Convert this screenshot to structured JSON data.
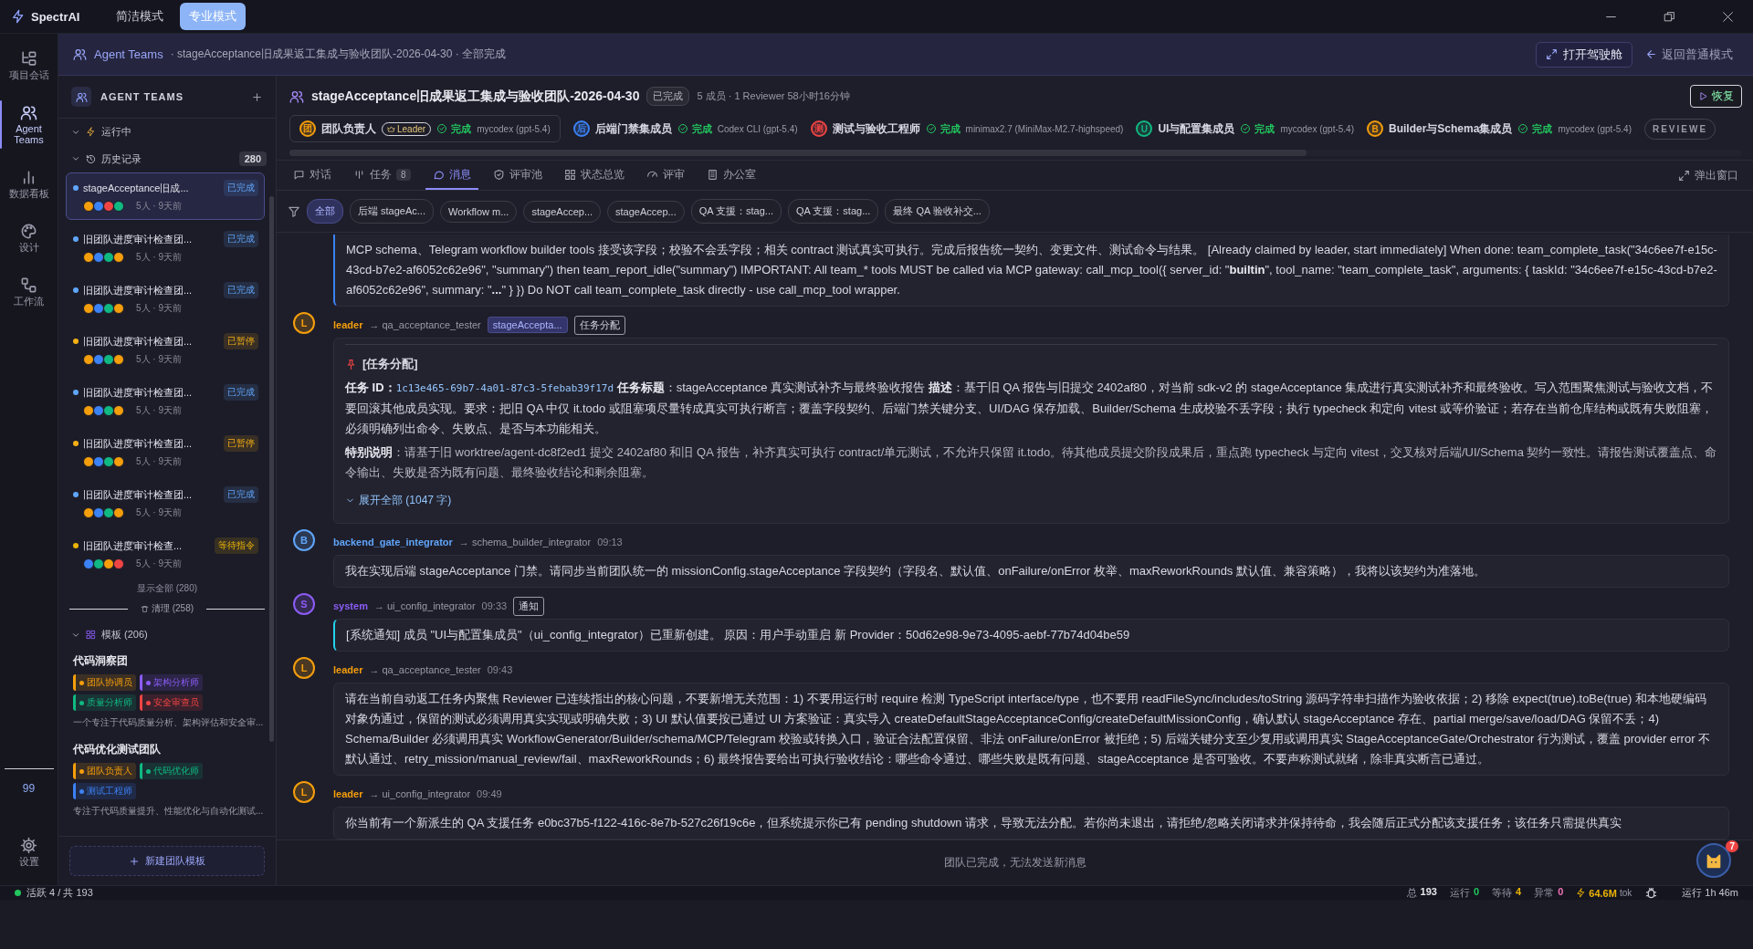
{
  "app": {
    "name": "SpectrAI",
    "modes": [
      {
        "label": "简洁模式",
        "selected": false
      },
      {
        "label": "专业模式",
        "selected": true
      }
    ]
  },
  "rail": {
    "items": [
      {
        "label": "项目会话",
        "selected": false
      },
      {
        "label": "Agent Teams",
        "selected": true
      },
      {
        "label": "数据看板",
        "selected": false
      },
      {
        "label": "设计",
        "selected": false
      },
      {
        "label": "工作流",
        "selected": false
      }
    ],
    "badge": "99",
    "settings": "设置"
  },
  "breadcrumb": {
    "section": "Agent Teams",
    "path": "· stageAcceptance旧成果返工集成与验收团队-2026-04-30 · 全部完成",
    "cockpit": "打开驾驶舱",
    "back": "返回普通模式"
  },
  "sidebar": {
    "title": "AGENT TEAMS",
    "running": "运行中",
    "history": "历史记录",
    "history_count": "280",
    "teams": [
      {
        "title": "stageAcceptance旧成...",
        "status": "已完成",
        "color": "#60a5fa",
        "meta": "5人 · 9天前",
        "selected": true,
        "avatars": [
          {
            "color": "#f59e0b"
          },
          {
            "color": "#3b82f6"
          },
          {
            "color": "#ef4444"
          },
          {
            "color": "#10b981"
          }
        ]
      },
      {
        "title": "旧团队进度审计检查团...",
        "status": "已完成",
        "color": "#60a5fa",
        "meta": "5人 · 9天前",
        "selected": false,
        "avatars": [
          {
            "color": "#f59e0b"
          },
          {
            "color": "#3b82f6"
          },
          {
            "color": "#10b981"
          },
          {
            "color": "#f59e0b"
          }
        ]
      },
      {
        "title": "旧团队进度审计检查团...",
        "status": "已完成",
        "color": "#60a5fa",
        "meta": "5人 · 9天前",
        "selected": false,
        "avatars": [
          {
            "color": "#f59e0b"
          },
          {
            "color": "#3b82f6"
          },
          {
            "color": "#10b981"
          },
          {
            "color": "#f59e0b"
          }
        ]
      },
      {
        "title": "旧团队进度审计检查团...",
        "status": "已暂停",
        "color": "#f5b014",
        "meta": "5人 · 9天前",
        "selected": false,
        "avatars": [
          {
            "color": "#f59e0b"
          },
          {
            "color": "#3b82f6"
          },
          {
            "color": "#10b981"
          },
          {
            "color": "#f59e0b"
          }
        ]
      },
      {
        "title": "旧团队进度审计检查团...",
        "status": "已完成",
        "color": "#60a5fa",
        "meta": "5人 · 9天前",
        "selected": false,
        "avatars": [
          {
            "color": "#f59e0b"
          },
          {
            "color": "#3b82f6"
          },
          {
            "color": "#10b981"
          },
          {
            "color": "#f59e0b"
          }
        ]
      },
      {
        "title": "旧团队进度审计检查团...",
        "status": "已暂停",
        "color": "#f5b014",
        "meta": "5人 · 9天前",
        "selected": false,
        "avatars": [
          {
            "color": "#f59e0b"
          },
          {
            "color": "#3b82f6"
          },
          {
            "color": "#10b981"
          },
          {
            "color": "#f59e0b"
          }
        ]
      },
      {
        "title": "旧团队进度审计检查团...",
        "status": "已完成",
        "color": "#60a5fa",
        "meta": "5人 · 9天前",
        "selected": false,
        "avatars": [
          {
            "color": "#f59e0b"
          },
          {
            "color": "#3b82f6"
          },
          {
            "color": "#10b981"
          },
          {
            "color": "#f59e0b"
          }
        ]
      },
      {
        "title": "旧团队进度审计检查...",
        "status": "等待指令",
        "color": "#eab308",
        "meta": "5人 · 9天前",
        "selected": false,
        "avatars": [
          {
            "color": "#3b82f6"
          },
          {
            "color": "#10b981"
          },
          {
            "color": "#f59e0b"
          },
          {
            "color": "#ef4444"
          }
        ]
      }
    ],
    "show_all": "显示全部 (280)",
    "cleanup": "清理 (258)",
    "templates_label": "模板 (206)",
    "templates": [
      {
        "name": "代码洞察团",
        "roles": [
          {
            "label": "团队协调员",
            "color": "#f59e0b"
          },
          {
            "label": "架构分析师",
            "color": "#8b5cf6"
          },
          {
            "label": "质量分析师",
            "color": "#10b981"
          },
          {
            "label": "安全审查员",
            "color": "#ef4444"
          }
        ],
        "description": "一个专注于代码质量分析、架构评估和安全审..."
      },
      {
        "name": "代码优化测试团队",
        "roles": [
          {
            "label": "团队负责人",
            "color": "#f59e0b"
          },
          {
            "label": "代码优化师",
            "color": "#10b981"
          },
          {
            "label": "测试工程师",
            "color": "#3b82f6"
          }
        ],
        "description": "专注于代码质量提升、性能优化与自动化测试..."
      }
    ],
    "new_template": "新建团队模板"
  },
  "team": {
    "title": "stageAcceptance旧成果返工集成与验收团队-2026-04-30",
    "status": "已完成",
    "meta": "5 成员 · 1 Reviewer 58小时16分钟",
    "resume": "恢复",
    "members": [
      {
        "avatar": "团",
        "color": "#f59e0b",
        "name": "团队负责人",
        "badge": "Leader",
        "status": "完成",
        "model": "mycodex (gpt-5.4)"
      },
      {
        "avatar": "后",
        "color": "#3b82f6",
        "name": "后端门禁集成员",
        "status": "完成",
        "model": "Codex CLI (gpt-5.4)"
      },
      {
        "avatar": "测",
        "color": "#ef4444",
        "name": "测试与验收工程师",
        "status": "完成",
        "model": "minimax2.7 (MiniMax-M2.7-highspeed)"
      },
      {
        "avatar": "U",
        "color": "#10b981",
        "name": "UI与配置集成员",
        "status": "完成",
        "model": "mycodex (gpt-5.4)"
      },
      {
        "avatar": "B",
        "color": "#f59e0b",
        "name": "Builder与Schema集成员",
        "status": "完成",
        "model": "mycodex (gpt-5.4)"
      }
    ],
    "reviewer": "REVIEWE"
  },
  "tabs": [
    {
      "label": "对话",
      "selected": false
    },
    {
      "label": "任务",
      "count": "8",
      "selected": false
    },
    {
      "label": "消息",
      "selected": true
    },
    {
      "label": "评审池",
      "selected": false
    },
    {
      "label": "状态总览",
      "selected": false
    },
    {
      "label": "评审",
      "selected": false
    },
    {
      "label": "办公室",
      "selected": false
    }
  ],
  "popout": "弹出窗口",
  "filters": [
    {
      "label": "全部",
      "selected": true
    },
    {
      "label": "后端 stageAc...",
      "selected": false
    },
    {
      "label": "Workflow m...",
      "selected": false
    },
    {
      "label": "stageAccep...",
      "selected": false
    },
    {
      "label": "stageAccep...",
      "selected": false
    },
    {
      "label": "QA 支援：stag...",
      "selected": false
    },
    {
      "label": "QA 支援：stag...",
      "selected": false
    },
    {
      "label": "最终 QA 验收补交...",
      "selected": false
    }
  ],
  "messages": [
    {
      "kind": "continuation",
      "text": "MCP schema、Telegram workflow builder tools 接受该字段；校验不会丢字段；相关 contract 测试真实可执行。完成后报告统一契约、变更文件、测试命令与结果。 [Already claimed by leader, start immediately] When done: team_complete_task(\"34c6ee7f-e15c-43cd-b7e2-af6052c62e96\", \"summary\") then team_report_idle(\"summary\") IMPORTANT: All team_* tools MUST be called via MCP gateway: call_mcp_tool({ server_id: \"**builtin**\", tool_name: \"team_complete_task\", arguments: { taskId: \"34c6ee7f-e15c-43cd-b7e2-af6052c62e96\", summary: \"**...**\" } }) Do NOT call team_complete_task directly - use call_mcp_tool wrapper."
    },
    {
      "kind": "task",
      "sender": "leader",
      "avatar": "L",
      "color": "#f59e0b",
      "to": "→ qa_acceptance_tester",
      "tags": [
        {
          "label": "stageAccepta...",
          "kind": "topic"
        },
        {
          "label": "任务分配",
          "kind": "type"
        }
      ],
      "heading": "[任务分配]",
      "id_label": "任务 ID：",
      "task_id": "1c13e465-69b7-4a01-87c3-5febab39f17d",
      "description": "**任务标题**：stageAcceptance 真实测试补齐与最终验收报告 **描述**：基于旧 QA 报告与旧提交 2402af80，对当前 sdk-v2 的 stageAcceptance 集成进行真实测试补齐和最终验收。写入范围聚焦测试与验收文档，不要回滚其他成员实现。要求：把旧 QA 中仅 it.todo 或阻塞项尽量转成真实可执行断言；覆盖字段契约、后端门禁关键分支、UI/DAG 保存加载、Builder/Schema 生成校验不丢字段；执行 typecheck 和定向 vitest 或等价验证；若存在当前仓库结构或既有失败阻塞，必须明确列出命令、失败点、是否与本功能相关。",
      "note": "**特别说明**：请基于旧 worktree/agent-dc8f2ed1 提交 2402af80 和旧 QA 报告，补齐真实可执行 contract/单元测试，不允许只保留 it.todo。待其他成员提交阶段成果后，重点跑 typecheck 与定向 vitest，交叉核对后端/UI/Schema 契约一致性。请报告测试覆盖点、命令输出、失败是否为既有问题、最终验收结论和剩余阻塞。",
      "expand": "展开全部 (1047 字)"
    },
    {
      "kind": "message",
      "sender": "backend_gate_integrator",
      "avatar": "B",
      "color": "#60a5fa",
      "to": "→ schema_builder_integrator",
      "time": "09:13",
      "text": "我在实现后端 stageAcceptance 门禁。请同步当前团队统一的 missionConfig.stageAcceptance 字段契约（字段名、默认值、onFailure/onError 枚举、maxReworkRounds 默认值、兼容策略），我将以该契约为准落地。"
    },
    {
      "kind": "system",
      "sender": "system",
      "avatar": "S",
      "color": "#8b5cf6",
      "to": "→ ui_config_integrator",
      "time": "09:33",
      "tags": [
        {
          "label": "通知",
          "kind": "type"
        }
      ],
      "text": "[系统通知] 成员 \"UI与配置集成员\"（ui_config_integrator）已重新创建。 原因：用户手动重启 新 Provider：50d62e98-9e73-4095-aebf-77b74d04be59"
    },
    {
      "kind": "message",
      "sender": "leader",
      "avatar": "L",
      "color": "#f59e0b",
      "to": "→ qa_acceptance_tester",
      "time": "09:43",
      "text": "请在当前自动返工任务内聚焦 Reviewer 已连续指出的核心问题，不要新增无关范围：1) 不要用运行时 require 检测 TypeScript interface/type，也不要用 readFileSync/includes/toString 源码字符串扫描作为验收依据；2) 移除 expect(true).toBe(true) 和本地硬编码对象伪通过，保留的测试必须调用真实实现或明确失败；3) UI 默认值要按已通过 UI 方案验证：真实导入 createDefaultStageAcceptanceConfig/createDefaultMissionConfig，确认默认 stageAcceptance 存在、partial merge/save/load/DAG 保留不丢；4) Schema/Builder 必须调用真实 WorkflowGenerator/Builder/schema/MCP/Telegram 校验或转换入口，验证合法配置保留、非法 onFailure/onError 被拒绝；5) 后端关键分支至少复用或调用真实 StageAcceptanceGate/Orchestrator 行为测试，覆盖 provider error 不默认通过、retry_mission/manual_review/fail、maxReworkRounds；6) 最终报告要给出可执行验收结论：哪些命令通过、哪些失败是既有问题、stageAcceptance 是否可验收。不要声称测试就绪，除非真实断言已通过。"
    },
    {
      "kind": "message",
      "sender": "leader",
      "avatar": "L",
      "color": "#f59e0b",
      "to": "→ ui_config_integrator",
      "time": "09:49",
      "text": "你当前有一个新派生的 QA 支援任务 e0bc37b5-f122-416c-8e7b-527c26f19c6e，但系统提示你已有 pending shutdown 请求，导致无法分配。若你尚未退出，请拒绝/忽略关闭请求并保持待命，我会随后正式分配该支援任务；该任务只需提供真实"
    }
  ],
  "assistant": {
    "badge": "7"
  },
  "composer": {
    "notice": "团队已完成，无法发送新消息"
  },
  "status_bar": {
    "active": "活跃 4 / 共 193",
    "stats": [
      {
        "label": "总",
        "value": "193",
        "color": "#e5e7eb"
      },
      {
        "label": "运行",
        "value": "0",
        "color": "#22c55e"
      },
      {
        "label": "等待",
        "value": "4",
        "color": "#eab308"
      },
      {
        "label": "异常",
        "value": "0",
        "color": "#f472b6"
      }
    ],
    "tokens": "64.6M",
    "tokens_unit": "tok",
    "uptime": "运行 1h 46m"
  }
}
